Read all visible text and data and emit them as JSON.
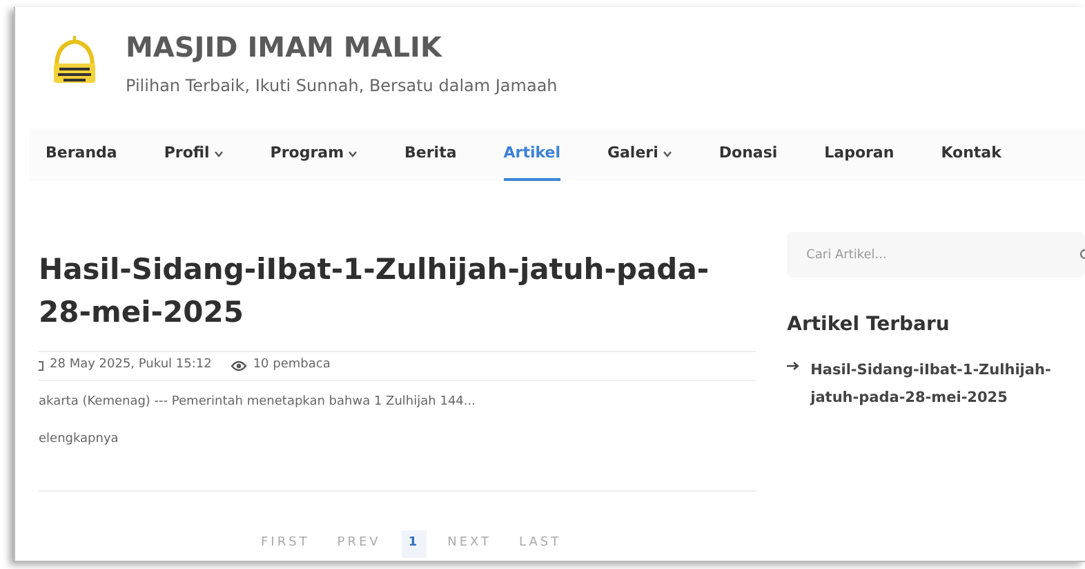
{
  "site": {
    "name": "MASJID IMAM MALIK",
    "tagline": "Pilihan Terbaik, Ikuti Sunnah, Bersatu dalam Jamaah"
  },
  "nav": [
    {
      "label": "Beranda",
      "dropdown": false,
      "selected": false
    },
    {
      "label": "Profil",
      "dropdown": true,
      "selected": false
    },
    {
      "label": "Program",
      "dropdown": true,
      "selected": false
    },
    {
      "label": "Berita",
      "dropdown": false,
      "selected": false
    },
    {
      "label": "Artikel",
      "dropdown": false,
      "selected": true
    },
    {
      "label": "Galeri",
      "dropdown": true,
      "selected": false
    },
    {
      "label": "Donasi",
      "dropdown": false,
      "selected": false
    },
    {
      "label": "Laporan",
      "dropdown": false,
      "selected": false
    },
    {
      "label": "Kontak",
      "dropdown": false,
      "selected": false
    }
  ],
  "article": {
    "title": "Hasil-Sidang-iIbat-1-Zulhijah-jatuh-pada-28-mei-2025",
    "date": "28 May 2025, Pukul 15:12",
    "views": "10 pembaca",
    "excerpt": "akarta (Kemenag) --- Pemerintah menetapkan bahwa 1 Zulhijah 144...",
    "read_more": "elengkapnya"
  },
  "pagination": [
    {
      "label": "FIRST",
      "selected": false
    },
    {
      "label": "PREV",
      "selected": false
    },
    {
      "label": "1",
      "selected": true
    },
    {
      "label": "NEXT",
      "selected": false
    },
    {
      "label": "LAST",
      "selected": false
    }
  ],
  "sidebar": {
    "search": {
      "placeholder": "Cari Artikel..."
    },
    "heading": "Artikel Terbaru",
    "links": [
      "Hasil-Sidang-iIbat-1-Zulhijah-jatuh-pada-28-mei-2025"
    ]
  }
}
